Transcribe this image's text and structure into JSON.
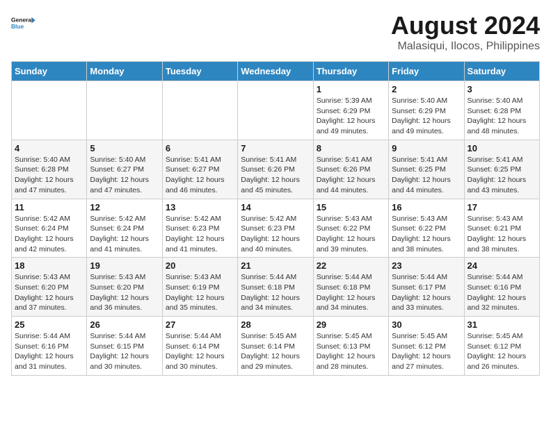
{
  "logo": {
    "line1": "General",
    "line2": "Blue"
  },
  "title": "August 2024",
  "subtitle": "Malasiqui, Ilocos, Philippines",
  "weekdays": [
    "Sunday",
    "Monday",
    "Tuesday",
    "Wednesday",
    "Thursday",
    "Friday",
    "Saturday"
  ],
  "weeks": [
    [
      {
        "day": "",
        "info": ""
      },
      {
        "day": "",
        "info": ""
      },
      {
        "day": "",
        "info": ""
      },
      {
        "day": "",
        "info": ""
      },
      {
        "day": "1",
        "info": "Sunrise: 5:39 AM\nSunset: 6:29 PM\nDaylight: 12 hours\nand 49 minutes."
      },
      {
        "day": "2",
        "info": "Sunrise: 5:40 AM\nSunset: 6:29 PM\nDaylight: 12 hours\nand 49 minutes."
      },
      {
        "day": "3",
        "info": "Sunrise: 5:40 AM\nSunset: 6:28 PM\nDaylight: 12 hours\nand 48 minutes."
      }
    ],
    [
      {
        "day": "4",
        "info": "Sunrise: 5:40 AM\nSunset: 6:28 PM\nDaylight: 12 hours\nand 47 minutes."
      },
      {
        "day": "5",
        "info": "Sunrise: 5:40 AM\nSunset: 6:27 PM\nDaylight: 12 hours\nand 47 minutes."
      },
      {
        "day": "6",
        "info": "Sunrise: 5:41 AM\nSunset: 6:27 PM\nDaylight: 12 hours\nand 46 minutes."
      },
      {
        "day": "7",
        "info": "Sunrise: 5:41 AM\nSunset: 6:26 PM\nDaylight: 12 hours\nand 45 minutes."
      },
      {
        "day": "8",
        "info": "Sunrise: 5:41 AM\nSunset: 6:26 PM\nDaylight: 12 hours\nand 44 minutes."
      },
      {
        "day": "9",
        "info": "Sunrise: 5:41 AM\nSunset: 6:25 PM\nDaylight: 12 hours\nand 44 minutes."
      },
      {
        "day": "10",
        "info": "Sunrise: 5:41 AM\nSunset: 6:25 PM\nDaylight: 12 hours\nand 43 minutes."
      }
    ],
    [
      {
        "day": "11",
        "info": "Sunrise: 5:42 AM\nSunset: 6:24 PM\nDaylight: 12 hours\nand 42 minutes."
      },
      {
        "day": "12",
        "info": "Sunrise: 5:42 AM\nSunset: 6:24 PM\nDaylight: 12 hours\nand 41 minutes."
      },
      {
        "day": "13",
        "info": "Sunrise: 5:42 AM\nSunset: 6:23 PM\nDaylight: 12 hours\nand 41 minutes."
      },
      {
        "day": "14",
        "info": "Sunrise: 5:42 AM\nSunset: 6:23 PM\nDaylight: 12 hours\nand 40 minutes."
      },
      {
        "day": "15",
        "info": "Sunrise: 5:43 AM\nSunset: 6:22 PM\nDaylight: 12 hours\nand 39 minutes."
      },
      {
        "day": "16",
        "info": "Sunrise: 5:43 AM\nSunset: 6:22 PM\nDaylight: 12 hours\nand 38 minutes."
      },
      {
        "day": "17",
        "info": "Sunrise: 5:43 AM\nSunset: 6:21 PM\nDaylight: 12 hours\nand 38 minutes."
      }
    ],
    [
      {
        "day": "18",
        "info": "Sunrise: 5:43 AM\nSunset: 6:20 PM\nDaylight: 12 hours\nand 37 minutes."
      },
      {
        "day": "19",
        "info": "Sunrise: 5:43 AM\nSunset: 6:20 PM\nDaylight: 12 hours\nand 36 minutes."
      },
      {
        "day": "20",
        "info": "Sunrise: 5:43 AM\nSunset: 6:19 PM\nDaylight: 12 hours\nand 35 minutes."
      },
      {
        "day": "21",
        "info": "Sunrise: 5:44 AM\nSunset: 6:18 PM\nDaylight: 12 hours\nand 34 minutes."
      },
      {
        "day": "22",
        "info": "Sunrise: 5:44 AM\nSunset: 6:18 PM\nDaylight: 12 hours\nand 34 minutes."
      },
      {
        "day": "23",
        "info": "Sunrise: 5:44 AM\nSunset: 6:17 PM\nDaylight: 12 hours\nand 33 minutes."
      },
      {
        "day": "24",
        "info": "Sunrise: 5:44 AM\nSunset: 6:16 PM\nDaylight: 12 hours\nand 32 minutes."
      }
    ],
    [
      {
        "day": "25",
        "info": "Sunrise: 5:44 AM\nSunset: 6:16 PM\nDaylight: 12 hours\nand 31 minutes."
      },
      {
        "day": "26",
        "info": "Sunrise: 5:44 AM\nSunset: 6:15 PM\nDaylight: 12 hours\nand 30 minutes."
      },
      {
        "day": "27",
        "info": "Sunrise: 5:44 AM\nSunset: 6:14 PM\nDaylight: 12 hours\nand 30 minutes."
      },
      {
        "day": "28",
        "info": "Sunrise: 5:45 AM\nSunset: 6:14 PM\nDaylight: 12 hours\nand 29 minutes."
      },
      {
        "day": "29",
        "info": "Sunrise: 5:45 AM\nSunset: 6:13 PM\nDaylight: 12 hours\nand 28 minutes."
      },
      {
        "day": "30",
        "info": "Sunrise: 5:45 AM\nSunset: 6:12 PM\nDaylight: 12 hours\nand 27 minutes."
      },
      {
        "day": "31",
        "info": "Sunrise: 5:45 AM\nSunset: 6:12 PM\nDaylight: 12 hours\nand 26 minutes."
      }
    ]
  ]
}
